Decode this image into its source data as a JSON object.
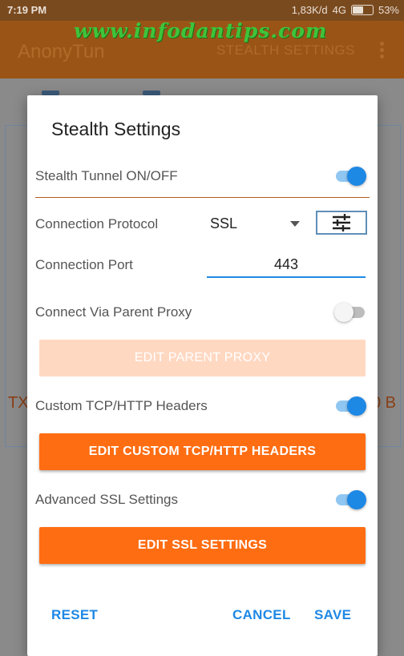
{
  "status_bar": {
    "time": "7:19 PM",
    "network_speed": "1,83K/d",
    "network_type": "4G",
    "battery_percent": "53%"
  },
  "app_bar": {
    "title": "AnonyTun",
    "action_label": "STEALTH SETTINGS",
    "overflow_icon": "more-vert-icon"
  },
  "watermark": "www.infodantips.com",
  "background": {
    "left_text": "TX",
    "right_text": "0 B"
  },
  "dialog": {
    "title": "Stealth Settings",
    "stealth_tunnel": {
      "label": "Stealth Tunnel ON/OFF",
      "enabled": true
    },
    "connection_protocol": {
      "label": "Connection Protocol",
      "selected": "SSL",
      "settings_icon": "sliders-icon"
    },
    "connection_port": {
      "label": "Connection Port",
      "value": "443"
    },
    "parent_proxy": {
      "label": "Connect Via Parent Proxy",
      "enabled": false,
      "button_label": "EDIT PARENT PROXY"
    },
    "custom_headers": {
      "label": "Custom TCP/HTTP Headers",
      "enabled": true,
      "button_label": "EDIT CUSTOM TCP/HTTP HEADERS"
    },
    "ssl_settings": {
      "label": "Advanced SSL Settings",
      "enabled": true,
      "button_label": "EDIT SSL SETTINGS"
    },
    "actions": {
      "reset": "RESET",
      "cancel": "CANCEL",
      "save": "SAVE"
    }
  },
  "colors": {
    "accent_orange": "#ff6d12",
    "accent_blue": "#1e88e5",
    "disabled_orange": "#ffd8c2"
  }
}
